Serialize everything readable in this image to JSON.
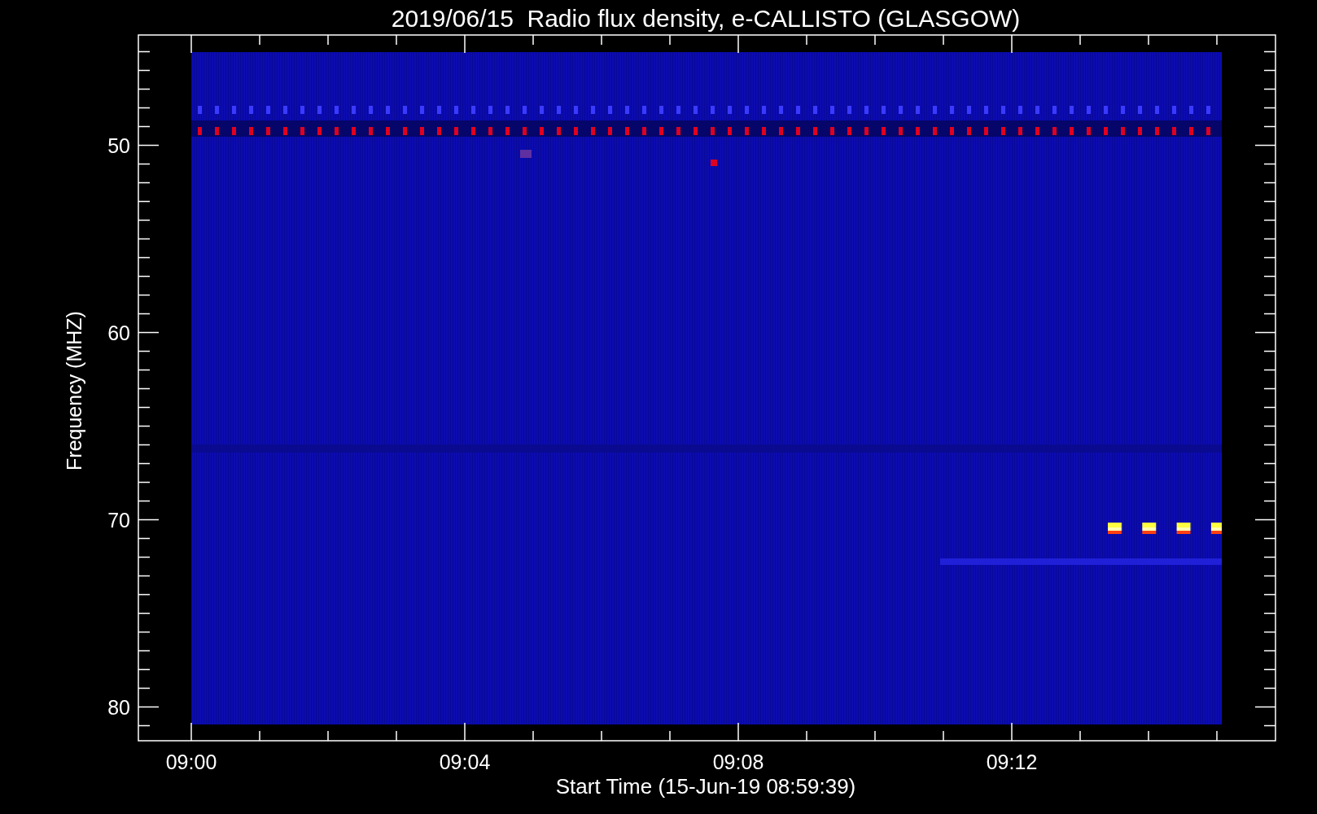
{
  "title": "2019/06/15  Radio flux density, e-CALLISTO (GLASGOW)",
  "plot": {
    "y_axis": {
      "label": "Frequency (MHZ)",
      "tick_labels": [
        "50",
        "60",
        "70",
        "80"
      ]
    },
    "x_axis": {
      "label": "Start Time (15-Jun-19 08:59:39)",
      "tick_labels": [
        "09:00",
        "09:04",
        "09:08",
        "09:12"
      ]
    }
  }
}
